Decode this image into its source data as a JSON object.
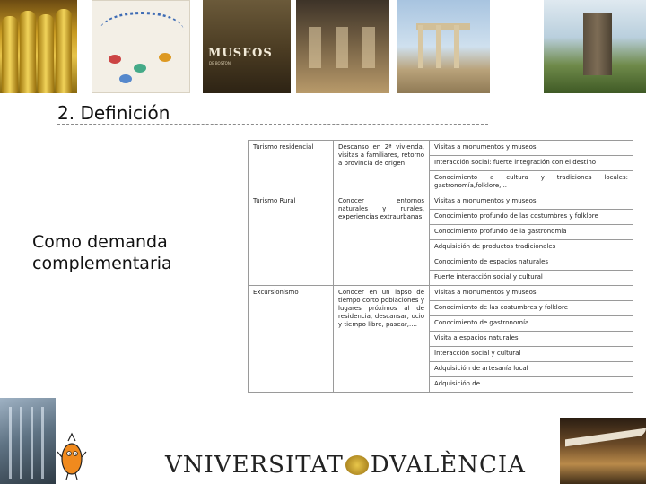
{
  "slide": {
    "title": "2. Definición",
    "side_label": "Como demanda complementaria"
  },
  "header_images": {
    "museos_label": "MUSEOS",
    "museos_sub": "DE BOSTON"
  },
  "table": {
    "rows": [
      {
        "type": "Turismo residencial",
        "description": "Descanso en 2ª vivienda, visitas a familiares, retorno a provincia de origen",
        "activities": [
          "Visitas a monumentos y museos",
          "Interacción social: fuerte integración con el destino",
          "Conocimiento a cultura y tradiciones locales: gastronomía,folklore,..."
        ]
      },
      {
        "type": "Turismo Rural",
        "description": "Conocer entornos naturales y rurales, experiencias extraurbanas",
        "activities": [
          "Visitas a monumentos y museos",
          "Conocimiento profundo de las costumbres y folklore",
          "Conocimiento profundo de la gastronomía",
          "Adquisición de productos tradicionales",
          "Conocimiento de espacios naturales",
          "Fuerte interacción social y cultural"
        ]
      },
      {
        "type": "Excursionismo",
        "description": "Conocer en un lapso de tiempo corto poblaciones y lugares próximos al de residencia, descansar, ocio y tiempo libre, pasear,....",
        "activities": [
          "Visitas a monumentos y museos",
          "Conocimiento de las costumbres y folklore",
          "Conocimiento de gastronomía",
          "Visita a espacios naturales",
          "Interacción social y cultural",
          "Adquisición de artesanía local",
          "Adquisición de"
        ]
      }
    ]
  },
  "footer": {
    "university_a": "VNIVERSITAT",
    "university_b": "D",
    "university_c": "VALÈNCIA"
  },
  "colors": {
    "border": "#9a9a9a",
    "text": "#222222"
  }
}
